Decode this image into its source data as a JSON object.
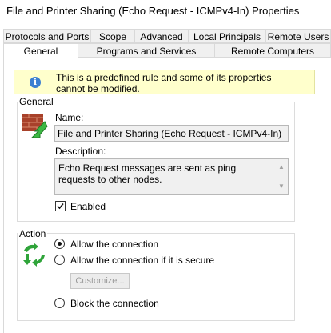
{
  "window": {
    "title": "File and Printer Sharing (Echo Request - ICMPv4-In) Properties"
  },
  "tabs_row_top": [
    {
      "label": "Protocols and Ports"
    },
    {
      "label": "Scope"
    },
    {
      "label": "Advanced"
    },
    {
      "label": "Local Principals"
    },
    {
      "label": "Remote Users"
    }
  ],
  "tabs_row_bottom": [
    {
      "label": "General",
      "active": true
    },
    {
      "label": "Programs and Services"
    },
    {
      "label": "Remote Computers"
    }
  ],
  "info_banner": {
    "text": "This is a predefined rule and some of its properties cannot be modified.",
    "icon": "info-icon"
  },
  "general_group": {
    "title": "General",
    "name_label": "Name:",
    "name_value": "File and Printer Sharing (Echo Request - ICMPv4-In)",
    "description_label": "Description:",
    "description_value": "Echo Request messages are sent as ping requests to other nodes.",
    "enabled_label": "Enabled",
    "enabled_checked": true,
    "icon": "firewall-rule-icon"
  },
  "action_group": {
    "title": "Action",
    "options": [
      {
        "label": "Allow the connection",
        "selected": true
      },
      {
        "label": "Allow the connection if it is secure",
        "selected": false
      },
      {
        "label": "Block the connection",
        "selected": false
      }
    ],
    "customize_label": "Customize...",
    "icon": "action-arrows-icon"
  },
  "colors": {
    "info_bg": "#ffffcc",
    "info_icon": "#3c7fd1",
    "arrow_green": "#2fa43a"
  }
}
